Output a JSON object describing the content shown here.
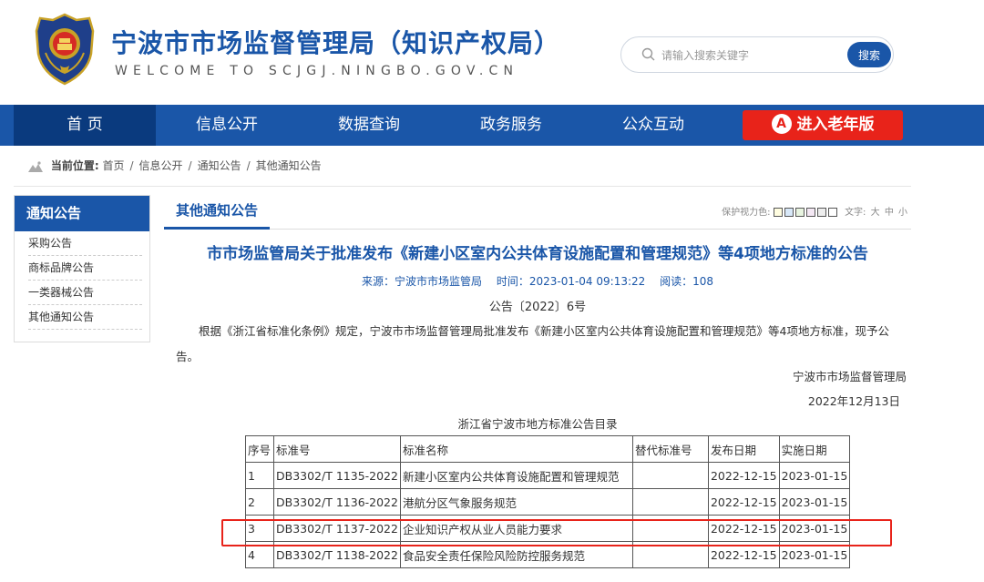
{
  "header": {
    "title": "宁波市市场监督管理局（知识产权局）",
    "subtitle": "WELCOME TO SCJGJ.NINGBO.GOV.CN",
    "search_placeholder": "请输入搜索关键字",
    "search_button": "搜索"
  },
  "nav": {
    "items": [
      "首 页",
      "信息公开",
      "数据查询",
      "政务服务",
      "公众互动"
    ],
    "elder_icon": "A",
    "elder_label": "进入老年版"
  },
  "breadcrumb": {
    "label": "当前位置:",
    "items": [
      "首页",
      "信息公开",
      "通知公告",
      "其他通知公告"
    ],
    "sep": "/"
  },
  "sidebar": {
    "title": "通知公告",
    "items": [
      "采购公告",
      "商标品牌公告",
      "一类器械公告",
      "其他通知公告"
    ]
  },
  "main": {
    "tab": "其他通知公告",
    "tools": {
      "vision_label": "保护视力色:",
      "swatch_colors": [
        "#fffde0",
        "#d8e8f8",
        "#e8f4e0",
        "#f4e8f4",
        "#eeeeee",
        "#ffffff"
      ],
      "font_label": "文字:",
      "font_sizes": [
        "大",
        "中",
        "小"
      ]
    },
    "article": {
      "title": "市市场监管局关于批准发布《新建小区室内公共体育设施配置和管理规范》等4项地方标准的公告",
      "source": "来源：宁波市市场监管局",
      "time": "时间：2023-01-04 09:13:22",
      "reads": "阅读：108",
      "doc_no": "公告〔2022〕6号",
      "body": "根据《浙江省标准化条例》规定，宁波市市场监督管理局批准发布《新建小区室内公共体育设施配置和管理规范》等4项地方标准，现予公告。",
      "sign_org": "宁波市市场监督管理局",
      "sign_date": "2022年12月13日",
      "table_title": "浙江省宁波市地方标准公告目录"
    },
    "table": {
      "headers": [
        "序号",
        "标准号",
        "标准名称",
        "替代标准号",
        "发布日期",
        "实施日期"
      ],
      "rows": [
        [
          "1",
          "DB3302/T 1135-2022",
          "新建小区室内公共体育设施配置和管理规范",
          "",
          "2022-12-15",
          "2023-01-15"
        ],
        [
          "2",
          "DB3302/T 1136-2022",
          "港航分区气象服务规范",
          "",
          "2022-12-15",
          "2023-01-15"
        ],
        [
          "3",
          "DB3302/T 1137-2022",
          "企业知识产权从业人员能力要求",
          "",
          "2022-12-15",
          "2023-01-15"
        ],
        [
          "4",
          "DB3302/T 1138-2022",
          "食品安全责任保险风险防控服务规范",
          "",
          "2022-12-15",
          "2023-01-15"
        ]
      ]
    }
  },
  "colors": {
    "brand_blue": "#1a56a8",
    "nav_active": "#0a3a7e",
    "elder_red": "#e8231a",
    "highlight_red": "#e8231a"
  }
}
